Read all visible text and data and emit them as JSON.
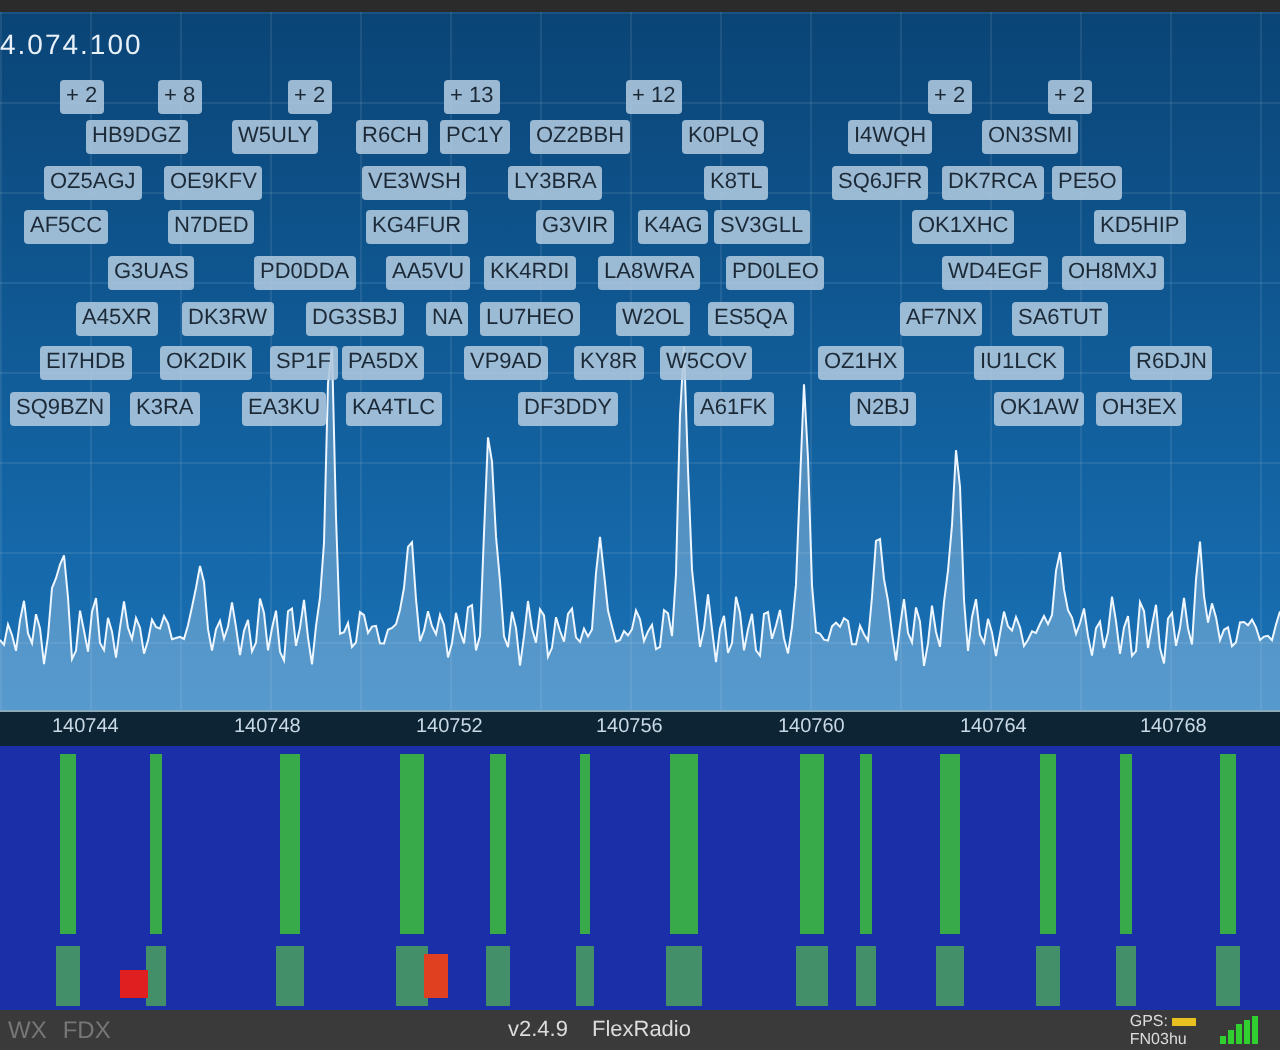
{
  "frequency": "4.074.100",
  "spot_counts": [
    "+ 2",
    "+ 8",
    "+ 2",
    "+ 13",
    "+ 12",
    "+ 2",
    "+ 2"
  ],
  "spot_rows": [
    [
      "HB9DGZ",
      "W5ULY",
      "R6CH",
      "PC1Y",
      "OZ2BBH",
      "K0PLQ",
      "I4WQH",
      "ON3SMI"
    ],
    [
      "OZ5AGJ",
      "OE9KFV",
      "VE3WSH",
      "LY3BRA",
      "K8TL",
      "SQ6JFR",
      "DK7RCA",
      "PE5O"
    ],
    [
      "AF5CC",
      "N7DED",
      "KG4FUR",
      "G3VIR",
      "K4AG",
      "SV3GLL",
      "OK1XHC",
      "KD5HIP"
    ],
    [
      "G3UAS",
      "PD0DDA",
      "AA5VU",
      "KK4RDI",
      "LA8WRA",
      "PD0LEO",
      "WD4EGF",
      "OH8MXJ"
    ],
    [
      "A45XR",
      "DK3RW",
      "DG3SBJ",
      "NA",
      "LU7HEO",
      "W2OL",
      "ES5QA",
      "AF7NX",
      "SA6TUT"
    ],
    [
      "EI7HDB",
      "OK2DIK",
      "SP1F",
      "PA5DX",
      "VP9AD",
      "KY8R",
      "W5COV",
      "OZ1HX",
      "IU1LCK",
      "R6DJN"
    ],
    [
      "SQ9BZN",
      "K3RA",
      "EA3KU",
      "KA4TLC",
      "DF3DDY",
      "A61FK",
      "N2BJ",
      "OK1AW",
      "OH3EX"
    ]
  ],
  "frequency_scale": [
    "140744",
    "140748",
    "140752",
    "140756",
    "140760",
    "140764",
    "140768"
  ],
  "status_bar": {
    "modes": [
      "WX",
      "FDX"
    ],
    "version": "v2.4.9",
    "brand": "FlexRadio",
    "gps_label": "GPS:",
    "grid_square": "FN03hu"
  }
}
